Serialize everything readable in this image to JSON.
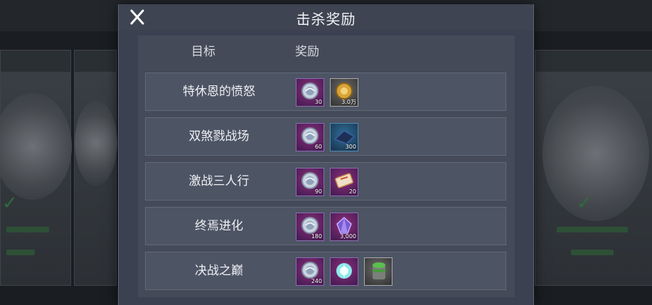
{
  "modal": {
    "title": "击杀奖励",
    "columns": {
      "target": "目标",
      "reward": "奖励"
    }
  },
  "rows": [
    {
      "name": "特休恩的愤怒",
      "rewards": [
        {
          "icon": "silver-coin-icon",
          "amount": "30",
          "frame": "purple"
        },
        {
          "icon": "gold-coin-icon",
          "amount": "3.0万",
          "frame": "grey"
        }
      ]
    },
    {
      "name": "双煞戮战场",
      "rewards": [
        {
          "icon": "silver-coin-icon",
          "amount": "60",
          "frame": "purple"
        },
        {
          "icon": "blue-ore-icon",
          "amount": "300",
          "frame": "blue"
        }
      ]
    },
    {
      "name": "激战三人行",
      "rewards": [
        {
          "icon": "silver-coin-icon",
          "amount": "90",
          "frame": "purple"
        },
        {
          "icon": "ticket-icon",
          "amount": "20",
          "frame": "purple"
        }
      ]
    },
    {
      "name": "终焉进化",
      "rewards": [
        {
          "icon": "silver-coin-icon",
          "amount": "180",
          "frame": "purple"
        },
        {
          "icon": "purple-crystal-icon",
          "amount": "3,000",
          "frame": "purple"
        }
      ]
    },
    {
      "name": "决战之巅",
      "rewards": [
        {
          "icon": "silver-coin-icon",
          "amount": "240",
          "frame": "purple"
        },
        {
          "icon": "cyan-gem-icon",
          "amount": "",
          "frame": "purple"
        },
        {
          "icon": "green-canister-icon",
          "amount": "",
          "frame": "grey"
        }
      ]
    }
  ],
  "colors": {
    "modal_bg": "#3b4150",
    "row_bg": "#4d5464",
    "purple_frame": "#8c6cb3",
    "blue_frame": "#4b8cb6"
  }
}
